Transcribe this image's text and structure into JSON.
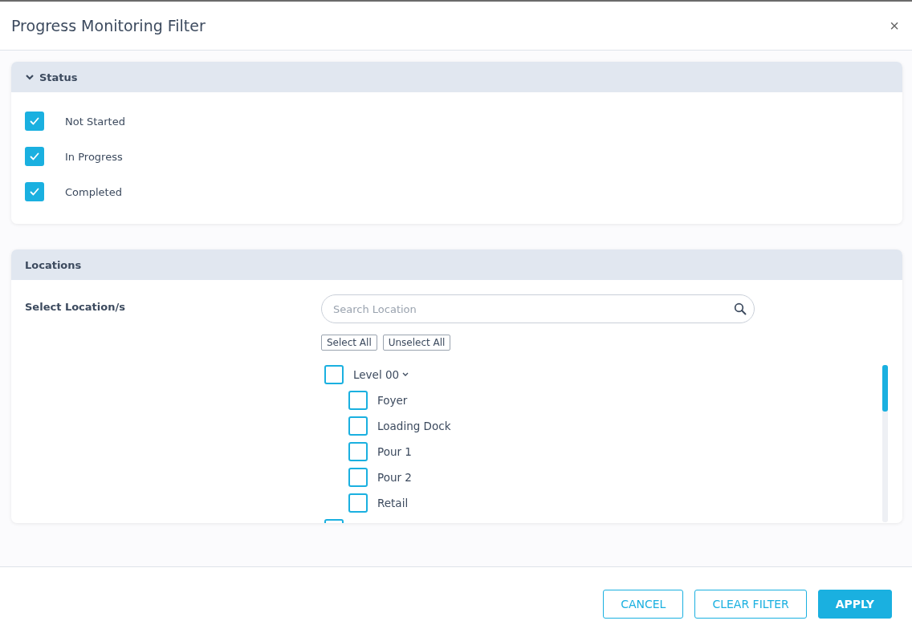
{
  "dialog": {
    "title": "Progress Monitoring Filter",
    "close": "×"
  },
  "status": {
    "title": "Status",
    "expanded": true,
    "options": [
      {
        "label": "Not Started",
        "checked": true
      },
      {
        "label": "In Progress",
        "checked": true
      },
      {
        "label": "Completed",
        "checked": true
      }
    ]
  },
  "locations": {
    "title": "Locations",
    "field_label": "Select Location/s",
    "search": {
      "placeholder": "Search Location"
    },
    "actions": [
      "Select All",
      "Unselect All"
    ],
    "tree": [
      {
        "label": "Level 00",
        "checked": false,
        "expanded": true,
        "children": [
          {
            "label": "Foyer",
            "checked": false
          },
          {
            "label": "Loading Dock",
            "checked": false
          },
          {
            "label": "Pour 1",
            "checked": false
          },
          {
            "label": "Pour 2",
            "checked": false
          },
          {
            "label": "Retail",
            "checked": false
          }
        ]
      },
      {
        "checked": false
      }
    ]
  },
  "buttons": [
    {
      "label": "CANCEL",
      "kind": "outline"
    },
    {
      "label": "CLEAR FILTER",
      "kind": "outline"
    },
    {
      "label": "APPLY",
      "kind": "primary"
    }
  ]
}
